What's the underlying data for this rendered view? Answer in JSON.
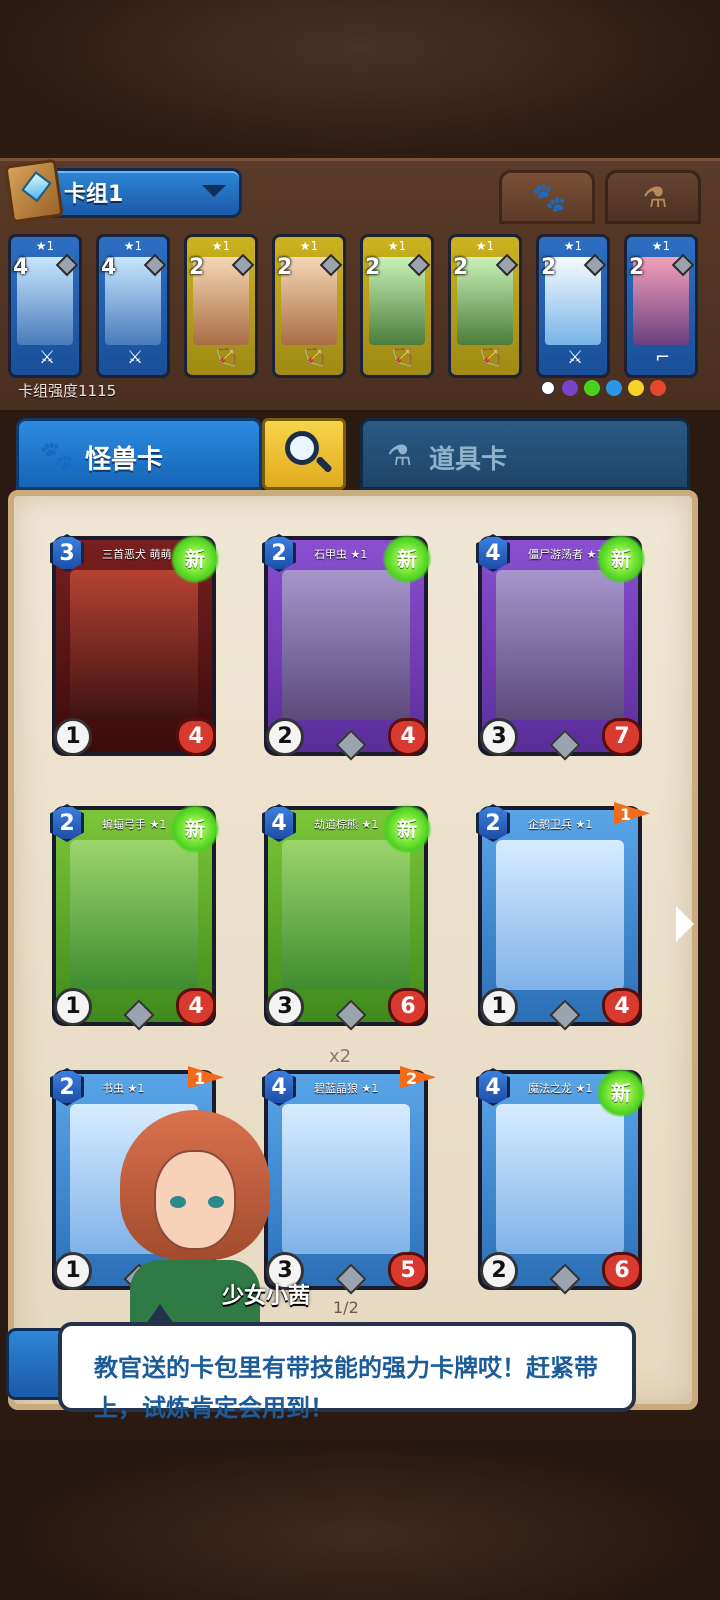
{
  "deck": {
    "name": "卡组1",
    "power_label": "卡组强度1115",
    "mini_cards": [
      {
        "star": "★1",
        "cost": "4",
        "theme": "blue"
      },
      {
        "star": "★1",
        "cost": "4",
        "theme": "blue"
      },
      {
        "star": "★1",
        "cost": "2",
        "theme": "gold"
      },
      {
        "star": "★1",
        "cost": "2",
        "theme": "gold"
      },
      {
        "star": "★1",
        "cost": "2",
        "theme": "gold"
      },
      {
        "star": "★1",
        "cost": "2",
        "theme": "gold"
      },
      {
        "star": "★1",
        "cost": "2",
        "theme": "blue"
      },
      {
        "star": "★1",
        "cost": "2",
        "theme": "blue"
      }
    ]
  },
  "tabs": {
    "paw_icon": "paw-icon",
    "potion_icon": "potion-icon"
  },
  "category_tabs": {
    "beast_label": "怪兽卡",
    "item_label": "道具卡"
  },
  "cards": [
    {
      "name": "三首恶犬 萌萌 ★1",
      "cost": "3",
      "atk": "1",
      "hp": "4",
      "badge": "新",
      "theme": "red"
    },
    {
      "name": "石甲虫 ★1",
      "cost": "2",
      "atk": "2",
      "hp": "4",
      "badge": "新",
      "theme": "purple"
    },
    {
      "name": "僵尸游荡者 ★1",
      "cost": "4",
      "atk": "3",
      "hp": "7",
      "badge": "新",
      "theme": "purple"
    },
    {
      "name": "蝙蝠弓手 ★1",
      "cost": "2",
      "atk": "1",
      "hp": "4",
      "badge": "新",
      "theme": "green"
    },
    {
      "name": "劫道棕熊 ★1",
      "cost": "4",
      "atk": "3",
      "hp": "6",
      "badge": "新",
      "theme": "green"
    },
    {
      "name": "企鹅卫兵 ★1",
      "cost": "2",
      "atk": "1",
      "hp": "4",
      "badge": "1",
      "theme": "ice"
    },
    {
      "name": "书虫 ★1",
      "cost": "2",
      "atk": "1",
      "hp": "",
      "badge": "1",
      "theme": "ice"
    },
    {
      "name": "碧蓝晶狼 ★1",
      "cost": "4",
      "atk": "3",
      "hp": "5",
      "badge": "2",
      "theme": "ice"
    },
    {
      "name": "魔法之龙 ★1",
      "cost": "4",
      "atk": "2",
      "hp": "6",
      "badge": "新",
      "theme": "ice"
    }
  ],
  "duplicate_count": "x2",
  "dialog": {
    "speaker": "少女小茜",
    "page": "1/2",
    "text": "教官送的卡包里有带技能的强力卡牌哎！赶紧带上，试炼肯定会用到！"
  }
}
